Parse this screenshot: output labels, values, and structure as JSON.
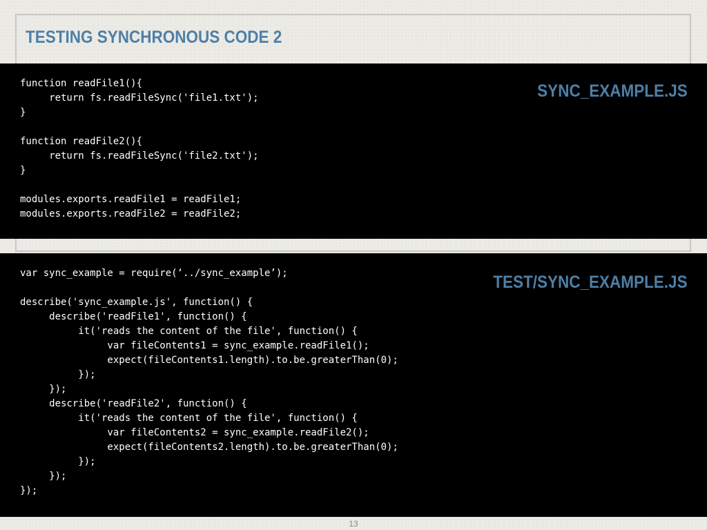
{
  "slide": {
    "title": "TESTING SYNCHRONOUS CODE 2",
    "page_number": "13"
  },
  "panels": [
    {
      "label": "SYNC_EXAMPLE.JS",
      "code": "function readFile1(){\n     return fs.readFileSync('file1.txt');\n}\n\nfunction readFile2(){\n     return fs.readFileSync('file2.txt');\n}\n\nmodules.exports.readFile1 = readFile1;\nmodules.exports.readFile2 = readFile2;"
    },
    {
      "label": "TEST/SYNC_EXAMPLE.JS",
      "code": "var sync_example = require(‘../sync_example’);\n\ndescribe('sync_example.js', function() {\n     describe('readFile1', function() {\n          it('reads the content of the file', function() {\n               var fileContents1 = sync_example.readFile1();\n               expect(fileContents1.length).to.be.greaterThan(0);\n          });\n     });\n     describe('readFile2', function() {\n          it('reads the content of the file', function() {\n               var fileContents2 = sync_example.readFile2();\n               expect(fileContents2.length).to.be.greaterThan(0);\n          });\n     });\n});"
    }
  ],
  "colors": {
    "accent": "#4e7fa6",
    "code_background": "#000000",
    "code_text": "#ffffff"
  }
}
